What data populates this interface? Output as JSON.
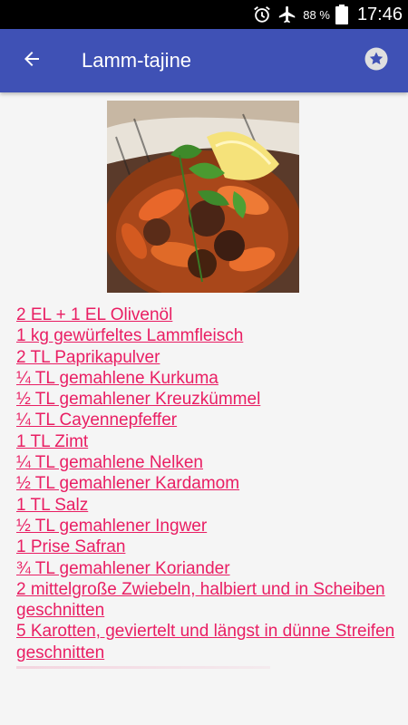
{
  "status_bar": {
    "battery_percent": "88 %",
    "time": "17:46",
    "icons": [
      "alarm-icon",
      "airplane-mode-icon",
      "battery-icon"
    ]
  },
  "app_bar": {
    "title": "Lamm-tajine",
    "back_icon": "arrow-back-icon",
    "favorite_icon": "star-icon",
    "background_color": "#3f51b5"
  },
  "recipe": {
    "photo_icon": "recipe-photo",
    "link_color": "#e91e63",
    "ingredients": [
      "2 EL + 1 EL Olivenöl",
      "1 kg gewürfeltes Lammfleisch",
      "2 TL Paprikapulver",
      "¼ TL gemahlene Kurkuma",
      "½ TL gemahlener Kreuzkümmel",
      "¼ TL Cayennepfeffer",
      "1 TL Zimt",
      "¼ TL gemahlene Nelken",
      "½ TL gemahlener Kardamom",
      "1 TL Salz",
      "½ TL gemahlener Ingwer",
      "1 Prise Safran",
      "¾ TL gemahlener Koriander",
      "2 mittelgroße Zwiebeln, halbiert und in Scheiben geschnitten",
      "5 Karotten, geviertelt und längst in dünne Streifen geschnitten"
    ]
  }
}
